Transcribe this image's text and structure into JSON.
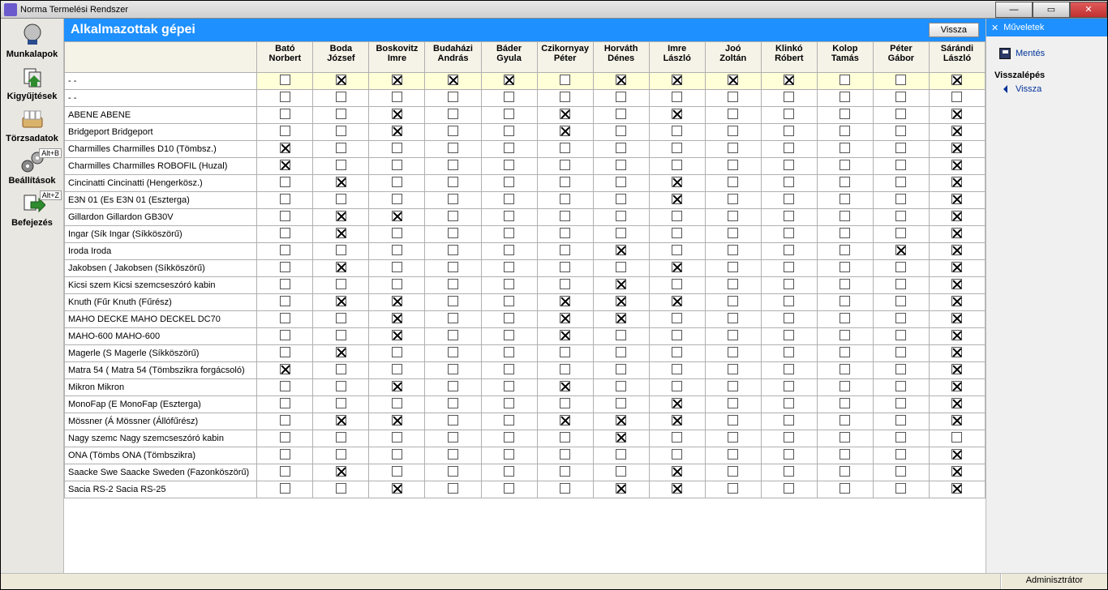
{
  "window": {
    "title": "Norma Termelési Rendszer"
  },
  "header": {
    "title": "Alkalmazottak gépei",
    "backButton": "Vissza"
  },
  "nav": {
    "items": [
      {
        "key": "munkalapok",
        "label": "Munkalapok"
      },
      {
        "key": "kigyujtesek",
        "label": "Kigyűjtések"
      },
      {
        "key": "torzsadatok",
        "label": "Törzsadatok"
      },
      {
        "key": "beallitasok",
        "label": "Beállítások",
        "shortcut": "Alt+B"
      },
      {
        "key": "befejezes",
        "label": "Befejezés",
        "shortcut": "Alt+Z"
      }
    ]
  },
  "sidebar": {
    "title": "Műveletek",
    "save": "Mentés",
    "backSection": "Visszalépés",
    "backLink": "Vissza"
  },
  "status": {
    "user": "Adminisztrátor"
  },
  "grid": {
    "highlightCol": 5,
    "highlightRow": 0,
    "columns": [
      {
        "l1": "Bató",
        "l2": "Norbert"
      },
      {
        "l1": "Boda",
        "l2": "József"
      },
      {
        "l1": "Boskovitz",
        "l2": "Imre"
      },
      {
        "l1": "Budaházi",
        "l2": "András"
      },
      {
        "l1": "Báder",
        "l2": "Gyula"
      },
      {
        "l1": "Czikornyay",
        "l2": "Péter"
      },
      {
        "l1": "Horváth",
        "l2": "Dénes"
      },
      {
        "l1": "Imre",
        "l2": "László"
      },
      {
        "l1": "Joó",
        "l2": "Zoltán"
      },
      {
        "l1": "Klinkó",
        "l2": "Róbert"
      },
      {
        "l1": "Kolop",
        "l2": "Tamás"
      },
      {
        "l1": "Péter",
        "l2": "Gábor"
      },
      {
        "l1": "Sárándi",
        "l2": "László"
      }
    ],
    "rows": [
      {
        "label": "-     -",
        "v": [
          0,
          1,
          1,
          1,
          1,
          0,
          1,
          1,
          1,
          1,
          0,
          0,
          1
        ]
      },
      {
        "label": "- -",
        "v": [
          0,
          0,
          0,
          0,
          0,
          0,
          0,
          0,
          0,
          0,
          0,
          0,
          0
        ]
      },
      {
        "label": "ABENE    ABENE",
        "v": [
          0,
          0,
          1,
          0,
          0,
          1,
          0,
          1,
          0,
          0,
          0,
          0,
          1
        ]
      },
      {
        "label": "Bridgeport Bridgeport",
        "v": [
          0,
          0,
          1,
          0,
          0,
          1,
          0,
          0,
          0,
          0,
          0,
          0,
          1
        ]
      },
      {
        "label": "Charmilles Charmilles D10 (Tömbsz.)",
        "v": [
          1,
          0,
          0,
          0,
          0,
          0,
          0,
          0,
          0,
          0,
          0,
          0,
          1
        ]
      },
      {
        "label": "Charmilles Charmilles ROBOFIL (Huzal)",
        "v": [
          1,
          0,
          0,
          0,
          0,
          0,
          0,
          0,
          0,
          0,
          0,
          0,
          1
        ]
      },
      {
        "label": "Cincinatti Cincinatti (Hengerkösz.)",
        "v": [
          0,
          1,
          0,
          0,
          0,
          0,
          0,
          1,
          0,
          0,
          0,
          0,
          1
        ]
      },
      {
        "label": "E3N 01 (Es E3N 01 (Eszterga)",
        "v": [
          0,
          0,
          0,
          0,
          0,
          0,
          0,
          1,
          0,
          0,
          0,
          0,
          1
        ]
      },
      {
        "label": "Gillardon  Gillardon GB30V",
        "v": [
          0,
          1,
          1,
          0,
          0,
          0,
          0,
          0,
          0,
          0,
          0,
          0,
          1
        ]
      },
      {
        "label": "Ingar (Sík Ingar (Síkköszörű)",
        "v": [
          0,
          1,
          0,
          0,
          0,
          0,
          0,
          0,
          0,
          0,
          0,
          0,
          1
        ]
      },
      {
        "label": "Iroda    Iroda",
        "v": [
          0,
          0,
          0,
          0,
          0,
          0,
          1,
          0,
          0,
          0,
          0,
          1,
          1
        ]
      },
      {
        "label": "Jakobsen ( Jakobsen (Síkköszörű)",
        "v": [
          0,
          1,
          0,
          0,
          0,
          0,
          0,
          1,
          0,
          0,
          0,
          0,
          1
        ]
      },
      {
        "label": "Kicsi szem Kicsi szemcseszóró kabin",
        "v": [
          0,
          0,
          0,
          0,
          0,
          0,
          1,
          0,
          0,
          0,
          0,
          0,
          1
        ]
      },
      {
        "label": "Knuth (Fűr Knuth (Fűrész)",
        "v": [
          0,
          1,
          1,
          0,
          0,
          1,
          1,
          1,
          0,
          0,
          0,
          0,
          1
        ]
      },
      {
        "label": "MAHO DECKE MAHO DECKEL DC70",
        "v": [
          0,
          0,
          1,
          0,
          0,
          1,
          1,
          0,
          0,
          0,
          0,
          0,
          1
        ]
      },
      {
        "label": "MAHO-600  MAHO-600",
        "v": [
          0,
          0,
          1,
          0,
          0,
          1,
          0,
          0,
          0,
          0,
          0,
          0,
          1
        ]
      },
      {
        "label": "Magerle (S Magerle (Síkköszörű)",
        "v": [
          0,
          1,
          0,
          0,
          0,
          0,
          0,
          0,
          0,
          0,
          0,
          0,
          1
        ]
      },
      {
        "label": "Matra 54 ( Matra 54 (Tömbszikra forgácsoló)",
        "v": [
          1,
          0,
          0,
          0,
          0,
          0,
          0,
          0,
          0,
          0,
          0,
          0,
          1
        ]
      },
      {
        "label": "Mikron    Mikron",
        "v": [
          0,
          0,
          1,
          0,
          0,
          1,
          0,
          0,
          0,
          0,
          0,
          0,
          1
        ]
      },
      {
        "label": "MonoFap (E MonoFap (Eszterga)",
        "v": [
          0,
          0,
          0,
          0,
          0,
          0,
          0,
          1,
          0,
          0,
          0,
          0,
          1
        ]
      },
      {
        "label": "Mössner (Á Mössner (Állófűrész)",
        "v": [
          0,
          1,
          1,
          0,
          0,
          1,
          1,
          1,
          0,
          0,
          0,
          0,
          1
        ]
      },
      {
        "label": "Nagy szemc Nagy szemcseszóró kabin",
        "v": [
          0,
          0,
          0,
          0,
          0,
          0,
          1,
          0,
          0,
          0,
          0,
          0,
          0
        ]
      },
      {
        "label": "ONA (Tömbs ONA (Tömbszikra)",
        "v": [
          0,
          0,
          0,
          0,
          0,
          0,
          0,
          0,
          0,
          0,
          0,
          0,
          1
        ]
      },
      {
        "label": "Saacke Swe Saacke Sweden (Fazonköszörű)",
        "v": [
          0,
          1,
          0,
          0,
          0,
          0,
          0,
          1,
          0,
          0,
          0,
          0,
          1
        ]
      },
      {
        "label": "Sacia RS-2 Sacia RS-25",
        "v": [
          0,
          0,
          1,
          0,
          0,
          0,
          1,
          1,
          0,
          0,
          0,
          0,
          1
        ]
      }
    ]
  }
}
